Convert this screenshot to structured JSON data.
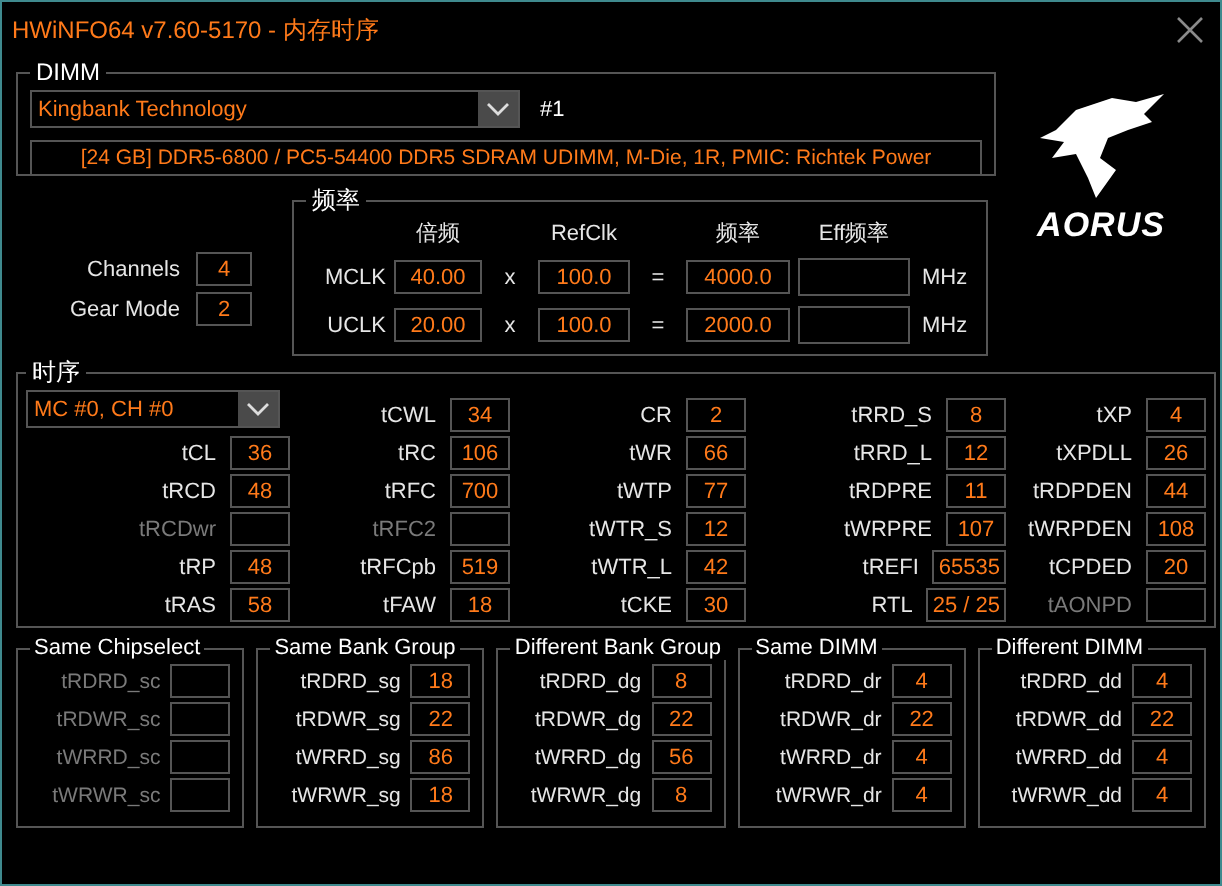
{
  "window": {
    "title": "HWiNFO64 v7.60-5170 - 内存时序"
  },
  "dimm": {
    "legend": "DIMM",
    "module": "Kingbank Technology",
    "slot": "#1",
    "description": "[24 GB] DDR5-6800 / PC5-54400 DDR5 SDRAM UDIMM, M-Die, 1R, PMIC: Richtek Power"
  },
  "logo": {
    "text": "AORUS"
  },
  "general": [
    {
      "label": "Channels",
      "value": "4"
    },
    {
      "label": "Gear Mode",
      "value": "2"
    }
  ],
  "frequency": {
    "legend": "频率",
    "headers": [
      "倍频",
      "RefClk",
      "频率",
      "Eff频率"
    ],
    "rows": [
      {
        "label": "MCLK",
        "multiplier": "40.00",
        "x": "x",
        "refclk": "100.0",
        "eq": "=",
        "freq": "4000.0",
        "unit": "MHz"
      },
      {
        "label": "UCLK",
        "multiplier": "20.00",
        "x": "x",
        "refclk": "100.0",
        "eq": "=",
        "freq": "2000.0",
        "unit": "MHz"
      }
    ]
  },
  "timings": {
    "legend": "时序",
    "channel": "MC #0, CH #0",
    "columns": [
      [
        {
          "label": "tCL",
          "value": "36",
          "disabled": false
        },
        {
          "label": "tRCD",
          "value": "48",
          "disabled": false
        },
        {
          "label": "tRCDwr",
          "disabled": true
        },
        {
          "label": "tRP",
          "value": "48",
          "disabled": false
        },
        {
          "label": "tRAS",
          "value": "58",
          "disabled": false
        }
      ],
      [
        {
          "label": "tCWL",
          "value": "34",
          "disabled": false
        },
        {
          "label": "tRC",
          "value": "106",
          "disabled": false
        },
        {
          "label": "tRFC",
          "value": "700",
          "disabled": false
        },
        {
          "label": "tRFC2",
          "disabled": true
        },
        {
          "label": "tRFCpb",
          "value": "519",
          "disabled": false
        },
        {
          "label": "tFAW",
          "value": "18",
          "disabled": false
        }
      ],
      [
        {
          "label": "CR",
          "value": "2",
          "disabled": false
        },
        {
          "label": "tWR",
          "value": "66",
          "disabled": false
        },
        {
          "label": "tWTP",
          "value": "77",
          "disabled": false
        },
        {
          "label": "tWTR_S",
          "value": "12",
          "disabled": false
        },
        {
          "label": "tWTR_L",
          "value": "42",
          "disabled": false
        },
        {
          "label": "tCKE",
          "value": "30",
          "disabled": false
        }
      ],
      [
        {
          "label": "tRRD_S",
          "value": "8",
          "disabled": false
        },
        {
          "label": "tRRD_L",
          "value": "12",
          "disabled": false
        },
        {
          "label": "tRDPRE",
          "value": "11",
          "disabled": false
        },
        {
          "label": "tWRPRE",
          "value": "107",
          "disabled": false
        },
        {
          "label": "tREFI",
          "value": "65535",
          "disabled": false
        },
        {
          "label": "RTL",
          "value": "25 / 25",
          "disabled": false
        }
      ],
      [
        {
          "label": "tXP",
          "value": "4",
          "disabled": false
        },
        {
          "label": "tXPDLL",
          "value": "26",
          "disabled": false
        },
        {
          "label": "tRDPDEN",
          "value": "44",
          "disabled": false
        },
        {
          "label": "tWRPDEN",
          "value": "108",
          "disabled": false
        },
        {
          "label": "tCPDED",
          "value": "20",
          "disabled": false
        },
        {
          "label": "tAONPD",
          "disabled": true
        }
      ]
    ]
  },
  "turnaround": [
    {
      "legend": "Same Chipselect",
      "items": [
        {
          "label": "tRDRD_sc",
          "disabled": true
        },
        {
          "label": "tRDWR_sc",
          "disabled": true
        },
        {
          "label": "tWRRD_sc",
          "disabled": true
        },
        {
          "label": "tWRWR_sc",
          "disabled": true
        }
      ]
    },
    {
      "legend": "Same Bank Group",
      "items": [
        {
          "label": "tRDRD_sg",
          "value": "18",
          "disabled": false
        },
        {
          "label": "tRDWR_sg",
          "value": "22",
          "disabled": false
        },
        {
          "label": "tWRRD_sg",
          "value": "86",
          "disabled": false
        },
        {
          "label": "tWRWR_sg",
          "value": "18",
          "disabled": false
        }
      ]
    },
    {
      "legend": "Different Bank Group",
      "items": [
        {
          "label": "tRDRD_dg",
          "value": "8",
          "disabled": false
        },
        {
          "label": "tRDWR_dg",
          "value": "22",
          "disabled": false
        },
        {
          "label": "tWRRD_dg",
          "value": "56",
          "disabled": false
        },
        {
          "label": "tWRWR_dg",
          "value": "8",
          "disabled": false
        }
      ]
    },
    {
      "legend": "Same DIMM",
      "items": [
        {
          "label": "tRDRD_dr",
          "value": "4",
          "disabled": false
        },
        {
          "label": "tRDWR_dr",
          "value": "22",
          "disabled": false
        },
        {
          "label": "tWRRD_dr",
          "value": "4",
          "disabled": false
        },
        {
          "label": "tWRWR_dr",
          "value": "4",
          "disabled": false
        }
      ]
    },
    {
      "legend": "Different DIMM",
      "items": [
        {
          "label": "tRDRD_dd",
          "value": "4",
          "disabled": false
        },
        {
          "label": "tRDWR_dd",
          "value": "22",
          "disabled": false
        },
        {
          "label": "tWRRD_dd",
          "value": "4",
          "disabled": false
        },
        {
          "label": "tWRWR_dd",
          "value": "4",
          "disabled": false
        }
      ]
    }
  ]
}
